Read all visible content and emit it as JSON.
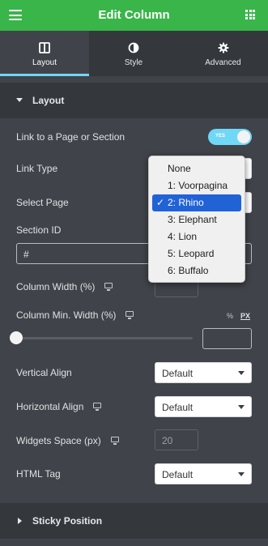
{
  "header": {
    "title": "Edit Column"
  },
  "tabs": [
    {
      "label": "Layout",
      "icon": "columns-icon",
      "active": true
    },
    {
      "label": "Style",
      "icon": "contrast-icon",
      "active": false
    },
    {
      "label": "Advanced",
      "icon": "gear-icon",
      "active": false
    }
  ],
  "sections": {
    "layout": {
      "title": "Layout",
      "expanded": true
    },
    "sticky": {
      "title": "Sticky Position",
      "expanded": false
    }
  },
  "fields": {
    "link_to_page": {
      "label": "Link to a Page or Section",
      "toggle_text": "YES",
      "value": true
    },
    "link_type": {
      "label": "Link Type"
    },
    "select_page": {
      "label": "Select Page"
    },
    "section_id": {
      "label": "Section ID",
      "value": "#"
    },
    "column_width": {
      "label": "Column Width (%)"
    },
    "column_min_width": {
      "label": "Column Min. Width (%)",
      "unit_pct": "%",
      "unit_px": "PX",
      "slider_value": 0
    },
    "vertical_align": {
      "label": "Vertical Align",
      "value": "Default"
    },
    "horizontal_align": {
      "label": "Horizontal Align",
      "value": "Default"
    },
    "widgets_space": {
      "label": "Widgets Space (px)",
      "placeholder": "20"
    },
    "html_tag": {
      "label": "HTML Tag",
      "value": "Default"
    }
  },
  "dropdown": {
    "options": [
      "None",
      "1: Voorpagina",
      "2: Rhino",
      "3: Elephant",
      "4: Lion",
      "5: Leopard",
      "6: Buffalo"
    ],
    "selected_index": 2,
    "check": "✓"
  },
  "colors": {
    "brand_green": "#39b54a",
    "accent_blue": "#71d7f7",
    "panel_bg": "#404349",
    "selection_blue": "#2162d7"
  }
}
